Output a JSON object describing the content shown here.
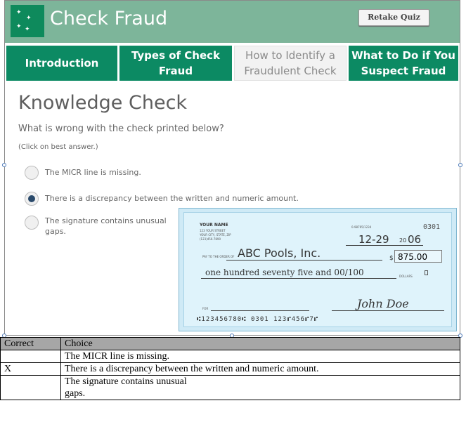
{
  "header": {
    "title": "Check Fraud",
    "retake_label": "Retake Quiz"
  },
  "tabs": [
    {
      "label": "Introduction",
      "active": false
    },
    {
      "label": "Types of Check Fraud",
      "active": false
    },
    {
      "label": "How to Identify a Fraudulent Check",
      "active": true
    },
    {
      "label": "What to Do if You Suspect Fraud",
      "active": false
    }
  ],
  "quiz": {
    "heading": "Knowledge Check",
    "question": "What is wrong with the check printed below?",
    "hint": "(Click on best answer.)",
    "options": [
      {
        "label": "The MICR line is missing.",
        "selected": false
      },
      {
        "label": "There is a discrepancy between the written and numeric amount.",
        "selected": true
      },
      {
        "label": "The signature contains unusual gaps.",
        "selected": false
      }
    ]
  },
  "check": {
    "name": "YOUR NAME",
    "address": [
      "123 YOUR STREET",
      "YOUR CITY, STATE, ZIP",
      "(123)456-7890"
    ],
    "number": "0301",
    "routing": "0-98765/1234",
    "date_month_day": "12-29",
    "date_sep": "20",
    "date_year": "06",
    "pay_to_label": "PAY TO THE ORDER OF",
    "payee": "ABC Pools, Inc.",
    "dollar_sign": "$",
    "amount_numeric": "875.00",
    "amount_words": "one hundred seventy five and 00/100",
    "dollars_label": "DOLLARS",
    "for_label": "FOR",
    "signature": "John Doe",
    "micr": "⑆123456780⑆ 0301 123⑈456⑈7⑈"
  },
  "table": {
    "headers": [
      "Correct",
      "Choice"
    ],
    "rows": [
      {
        "correct": "",
        "choice": "The MICR line is missing."
      },
      {
        "correct": "X",
        "choice": "There is a discrepancy between the written and numeric amount."
      },
      {
        "correct": "",
        "choice": "The signature contains unusual\ngaps."
      }
    ]
  },
  "colors": {
    "header_bg": "#7db59a",
    "tab_bg": "#0c8a63",
    "check_bg": "#cfeaf6"
  }
}
